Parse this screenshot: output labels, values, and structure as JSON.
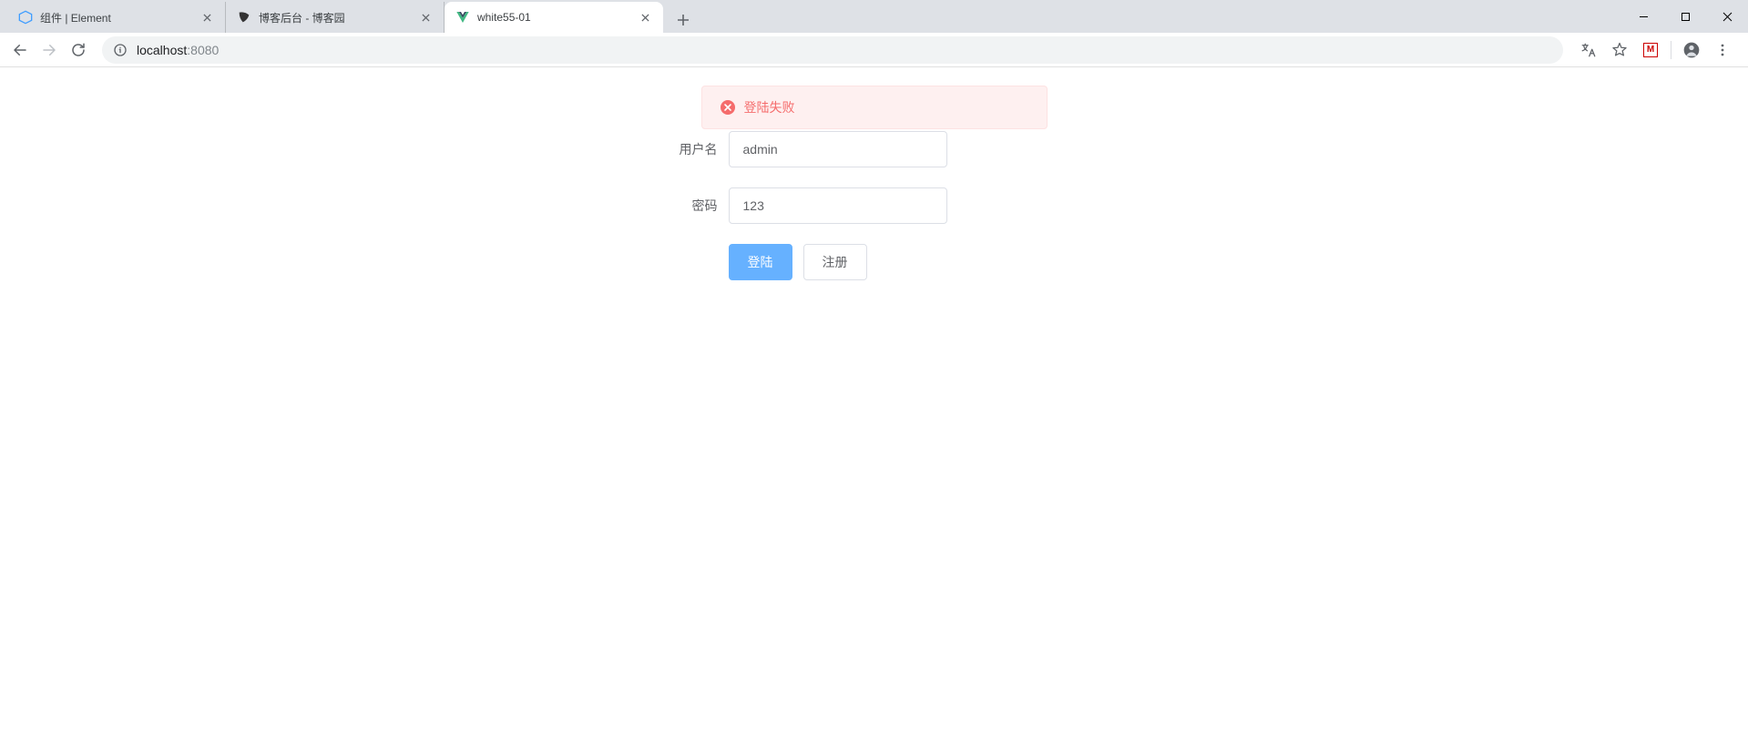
{
  "browser": {
    "tabs": [
      {
        "title": "组件 | Element",
        "favicon": "element",
        "active": false
      },
      {
        "title": "博客后台 - 博客园",
        "favicon": "cnblogs",
        "active": false
      },
      {
        "title": "white55-01",
        "favicon": "vue",
        "active": true
      }
    ],
    "address": {
      "host": "localhost",
      "port": ":8080"
    }
  },
  "message": {
    "text": "登陆失败"
  },
  "form": {
    "username_label": "用户名",
    "username_value": "admin",
    "password_label": "密码",
    "password_value": "123",
    "login_btn": "登陆",
    "register_btn": "注册"
  }
}
